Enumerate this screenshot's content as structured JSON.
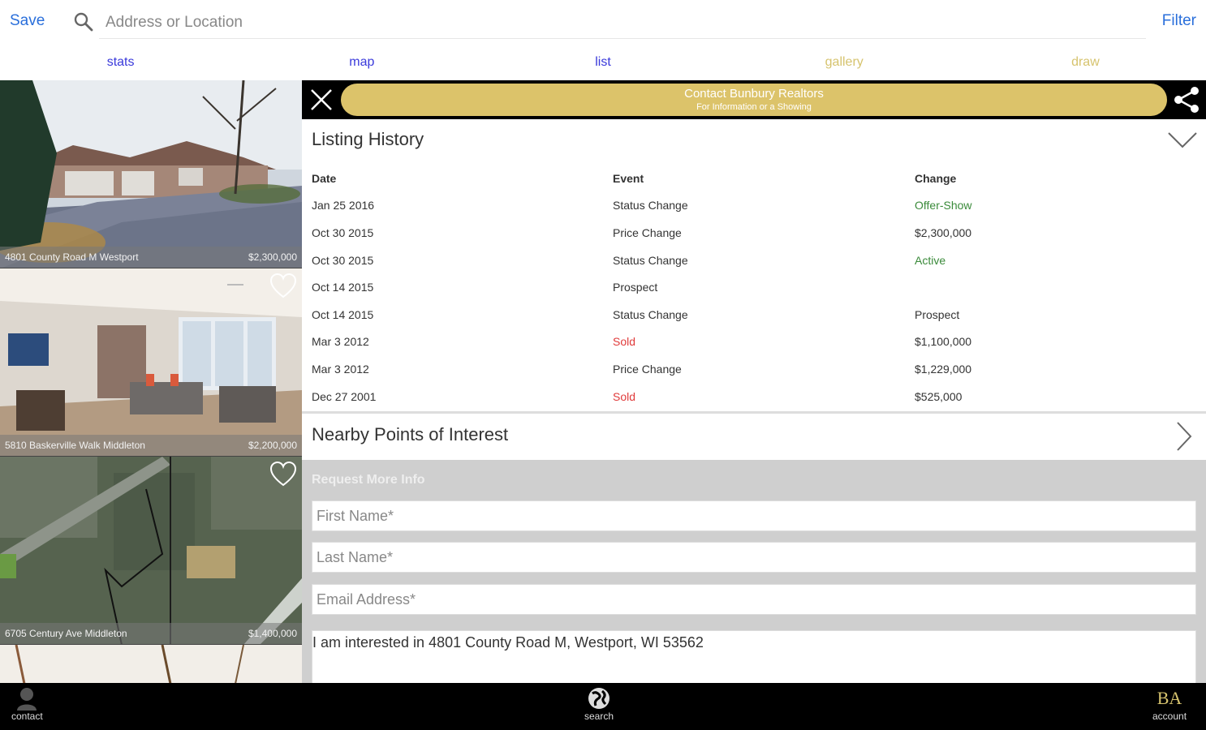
{
  "topbar": {
    "save_label": "Save",
    "search_placeholder": "Address or Location",
    "filter_label": "Filter"
  },
  "tabs": [
    {
      "label": "stats",
      "color": "#3a3adb"
    },
    {
      "label": "map",
      "color": "#3a3adb"
    },
    {
      "label": "list",
      "color": "#3a3adb"
    },
    {
      "label": "gallery",
      "color": "#d6c36e"
    },
    {
      "label": "draw",
      "color": "#d6c36e"
    }
  ],
  "listings": [
    {
      "address": "4801 County Road M Westport",
      "price": "$2,300,000"
    },
    {
      "address": "5810 Baskerville Walk Middleton",
      "price": "$2,200,000"
    },
    {
      "address": "6705 Century Ave Middleton",
      "price": "$1,400,000"
    }
  ],
  "contact": {
    "title": "Contact Bunbury Realtors",
    "subtitle": "For Information or a Showing"
  },
  "history": {
    "title": "Listing History",
    "headers": {
      "date": "Date",
      "event": "Event",
      "change": "Change"
    },
    "rows": [
      {
        "date": "Jan 25 2016",
        "event": "Status Change",
        "event_color": "#333333",
        "change": "Offer-Show",
        "change_color": "#3a8a3a"
      },
      {
        "date": "Oct 30 2015",
        "event": "Price Change",
        "event_color": "#333333",
        "change": "$2,300,000",
        "change_color": "#333333"
      },
      {
        "date": "Oct 30 2015",
        "event": "Status Change",
        "event_color": "#333333",
        "change": "Active",
        "change_color": "#3a8a3a"
      },
      {
        "date": "Oct 14 2015",
        "event": "Prospect",
        "event_color": "#333333",
        "change": "",
        "change_color": "#333333"
      },
      {
        "date": "Oct 14 2015",
        "event": "Status Change",
        "event_color": "#333333",
        "change": "Prospect",
        "change_color": "#333333"
      },
      {
        "date": "Mar 3 2012",
        "event": "Sold",
        "event_color": "#e03a3a",
        "change": "$1,100,000",
        "change_color": "#333333"
      },
      {
        "date": "Mar 3 2012",
        "event": "Price Change",
        "event_color": "#333333",
        "change": "$1,229,000",
        "change_color": "#333333"
      },
      {
        "date": "Dec 27 2001",
        "event": "Sold",
        "event_color": "#e03a3a",
        "change": "$525,000",
        "change_color": "#333333"
      }
    ]
  },
  "poi": {
    "title": "Nearby Points of Interest"
  },
  "request": {
    "title": "Request More Info",
    "first_name_placeholder": "First Name*",
    "last_name_placeholder": "Last Name*",
    "email_placeholder": "Email Address*",
    "message": "I am interested in 4801 County Road M, Westport, WI 53562"
  },
  "bottombar": {
    "contact_label": "contact",
    "search_label": "search",
    "account_label": "account",
    "logo_text": "BA"
  },
  "colors": {
    "accent": "#2a6fdb",
    "gold": "#dcc36a"
  }
}
